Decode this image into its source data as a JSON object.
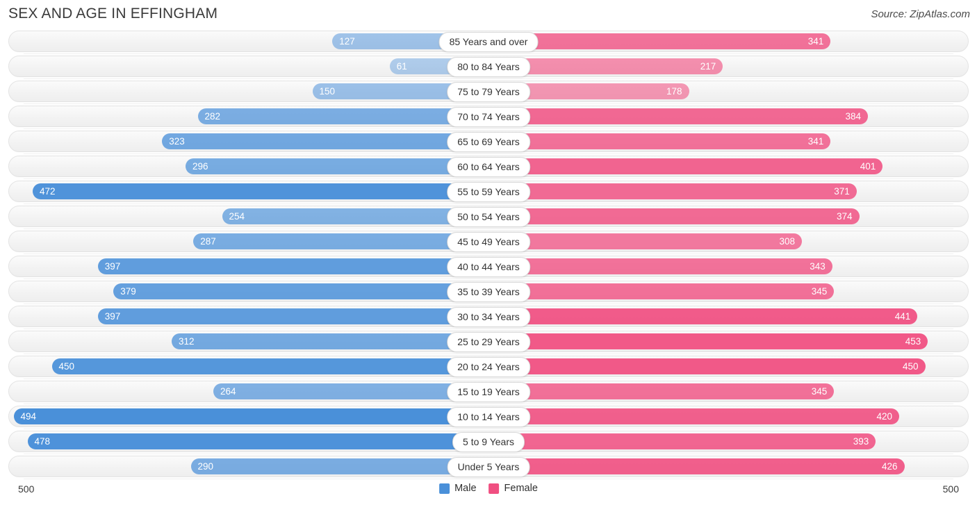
{
  "header": {
    "title": "SEX AND AGE IN EFFINGHAM",
    "source": "Source: ZipAtlas.com"
  },
  "footer": {
    "axis_left": "500",
    "axis_right": "500",
    "legend": [
      {
        "label": "Male",
        "color": "#4a90d9"
      },
      {
        "label": "Female",
        "color": "#f04f81"
      }
    ]
  },
  "chart_data": {
    "type": "bar",
    "subtype": "population-pyramid",
    "title": "SEX AND AGE IN EFFINGHAM",
    "xlabel": "",
    "ylabel": "",
    "axis_max": 500,
    "xlim": [
      0,
      500
    ],
    "grid": false,
    "legend_position": "bottom-center",
    "categories": [
      "85 Years and over",
      "80 to 84 Years",
      "75 to 79 Years",
      "70 to 74 Years",
      "65 to 69 Years",
      "60 to 64 Years",
      "55 to 59 Years",
      "50 to 54 Years",
      "45 to 49 Years",
      "40 to 44 Years",
      "35 to 39 Years",
      "30 to 34 Years",
      "25 to 29 Years",
      "20 to 24 Years",
      "15 to 19 Years",
      "10 to 14 Years",
      "5 to 9 Years",
      "Under 5 Years"
    ],
    "series": [
      {
        "name": "Male",
        "color": "#4a90d9",
        "direction": "left",
        "values": [
          127,
          61,
          150,
          282,
          323,
          296,
          472,
          254,
          287,
          397,
          379,
          397,
          312,
          450,
          264,
          494,
          478,
          290
        ]
      },
      {
        "name": "Female",
        "color": "#f04f81",
        "direction": "right",
        "values": [
          341,
          217,
          178,
          384,
          341,
          401,
          371,
          374,
          308,
          343,
          345,
          441,
          453,
          450,
          345,
          420,
          393,
          426
        ]
      }
    ]
  }
}
